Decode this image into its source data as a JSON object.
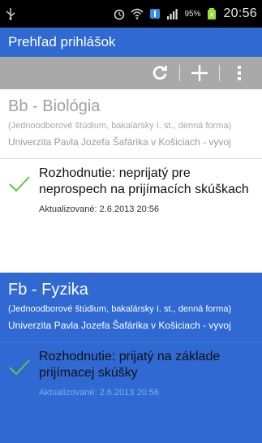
{
  "status_bar": {
    "battery": "95%",
    "time": "20:56",
    "icons": [
      "usb-icon",
      "alarm-icon",
      "wifi-icon",
      "data-icon",
      "signal-icon",
      "battery-icon"
    ]
  },
  "app": {
    "title": "Prehľad prihlášok",
    "accent_color": "#2f69d1"
  },
  "toolbar": {
    "buttons": [
      "refresh-icon",
      "add-icon",
      "overflow-menu-icon"
    ]
  },
  "applications": [
    {
      "subject": "Bb - Biológia",
      "program": "(Jednoodborové štúdium, bakalársky I. st., denná forma)",
      "university": "Univerzita Pavla Jozefa Šafárika v Košiciach - vyvoj",
      "decision": "Rozhodnutie: neprijatý pre neprospech na prijímacích skúškach",
      "updated": "Aktualizované: 2.6.2013 20:56",
      "selected": false
    },
    {
      "subject": "Fb - Fyzika",
      "program": "(Jednoodborové štúdium, bakalársky I. st., denná forma)",
      "university": "Univerzita Pavla Jozefa Šafárika v Košiciach - vyvoj",
      "decision": "Rozhodnutie: prijatý na základe prijímacej skúšky",
      "updated": "Aktualizované: 2.6.2013 20:56",
      "selected": true
    }
  ]
}
